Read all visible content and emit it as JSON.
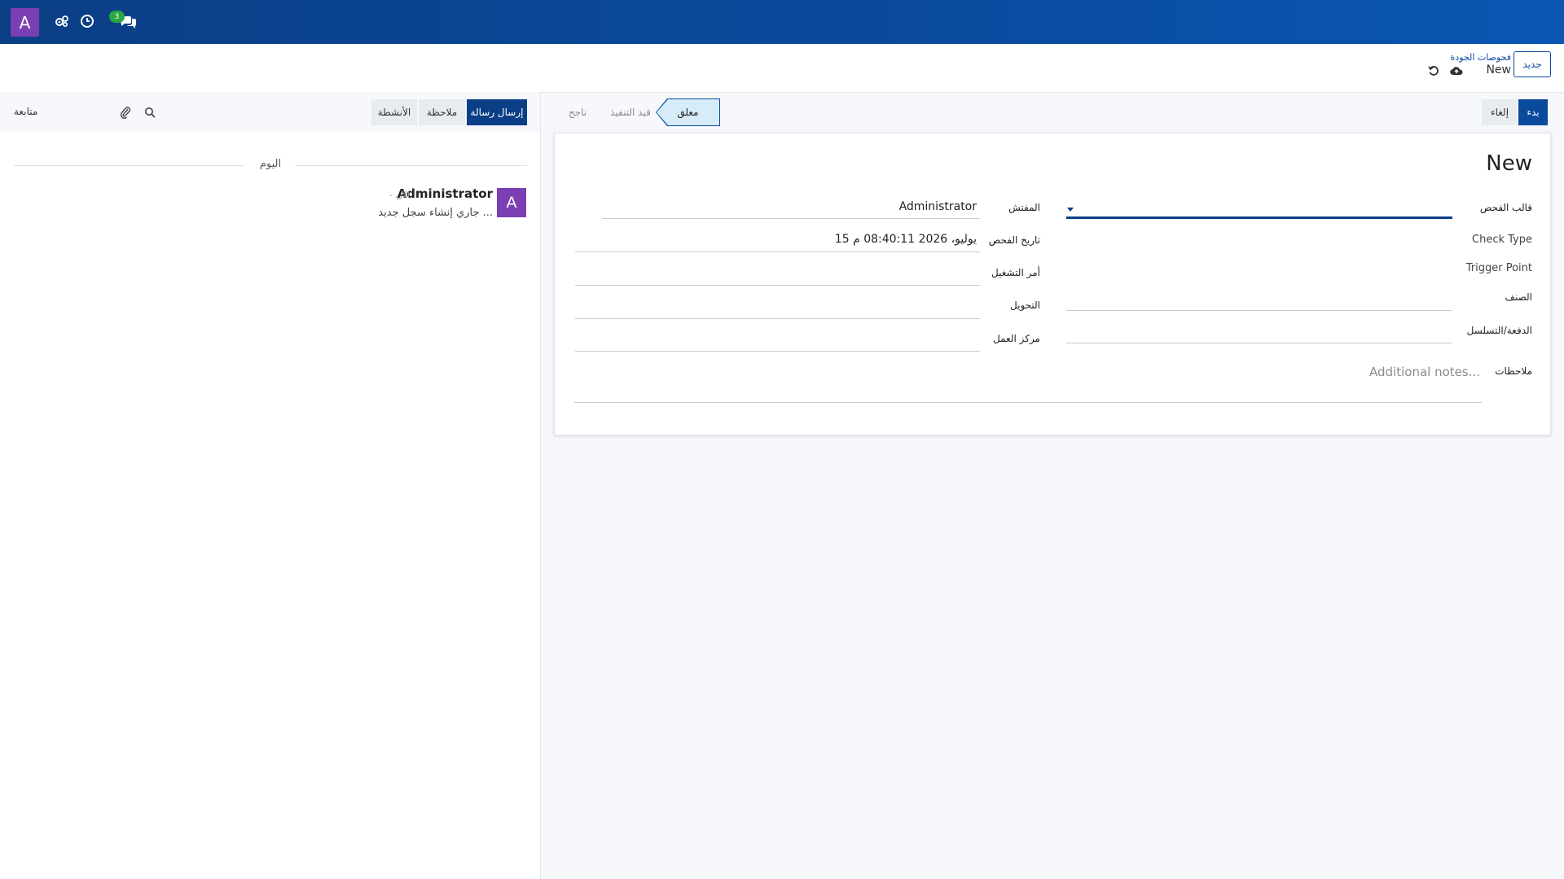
{
  "navbar": {
    "avatar_letter": "A",
    "badge_count": "3",
    "icons": [
      "gears-icon",
      "clock-icon",
      "chat-icon"
    ]
  },
  "control": {
    "new_button": "جديد",
    "breadcrumb_parent": "فحوصات الجودة",
    "breadcrumb_current": "New",
    "icons": [
      "cloud-upload-icon",
      "undo-icon"
    ]
  },
  "status": {
    "start_button": "بدء",
    "cancel_button": "إلغاء",
    "stages": [
      "معلق",
      "قيد التنفيذ",
      "ناجح"
    ],
    "active_stage": "معلق"
  },
  "form": {
    "title": "New",
    "labels": {
      "template": "قالب الفحص",
      "check_type": "Check Type",
      "trigger_point": "Trigger Point",
      "item": "الصنف",
      "batch": "الدفعة/التسلسل",
      "notes": "ملاحظات",
      "inspector": "المفتش",
      "check_date": "تاريخ الفحص",
      "work_order": "أمر التشغيل",
      "transfer": "التحويل",
      "work_center": "مركز العمل"
    },
    "values": {
      "inspector": "Administrator",
      "check_date": "15 يوليو، 2026 08:40:11 م"
    },
    "notes_placeholder": "Additional notes..."
  },
  "chatter": {
    "send_message": "إرسال رسالة",
    "log_note": "ملاحظة",
    "activities": "الأنشطة",
    "follow": "متابعة",
    "icons": [
      "search-icon",
      "paperclip-icon"
    ],
    "date_separator": "اليوم",
    "message": {
      "avatar_letter": "A",
      "author": "Administrator",
      "time": "- الآن",
      "body": "جاري إنشاء سجل جديد ..."
    }
  },
  "colors": {
    "navbar": "#0a4a9c",
    "primary": "#0a3f86",
    "avatar": "#7b3fb3",
    "badge": "#28a745"
  }
}
